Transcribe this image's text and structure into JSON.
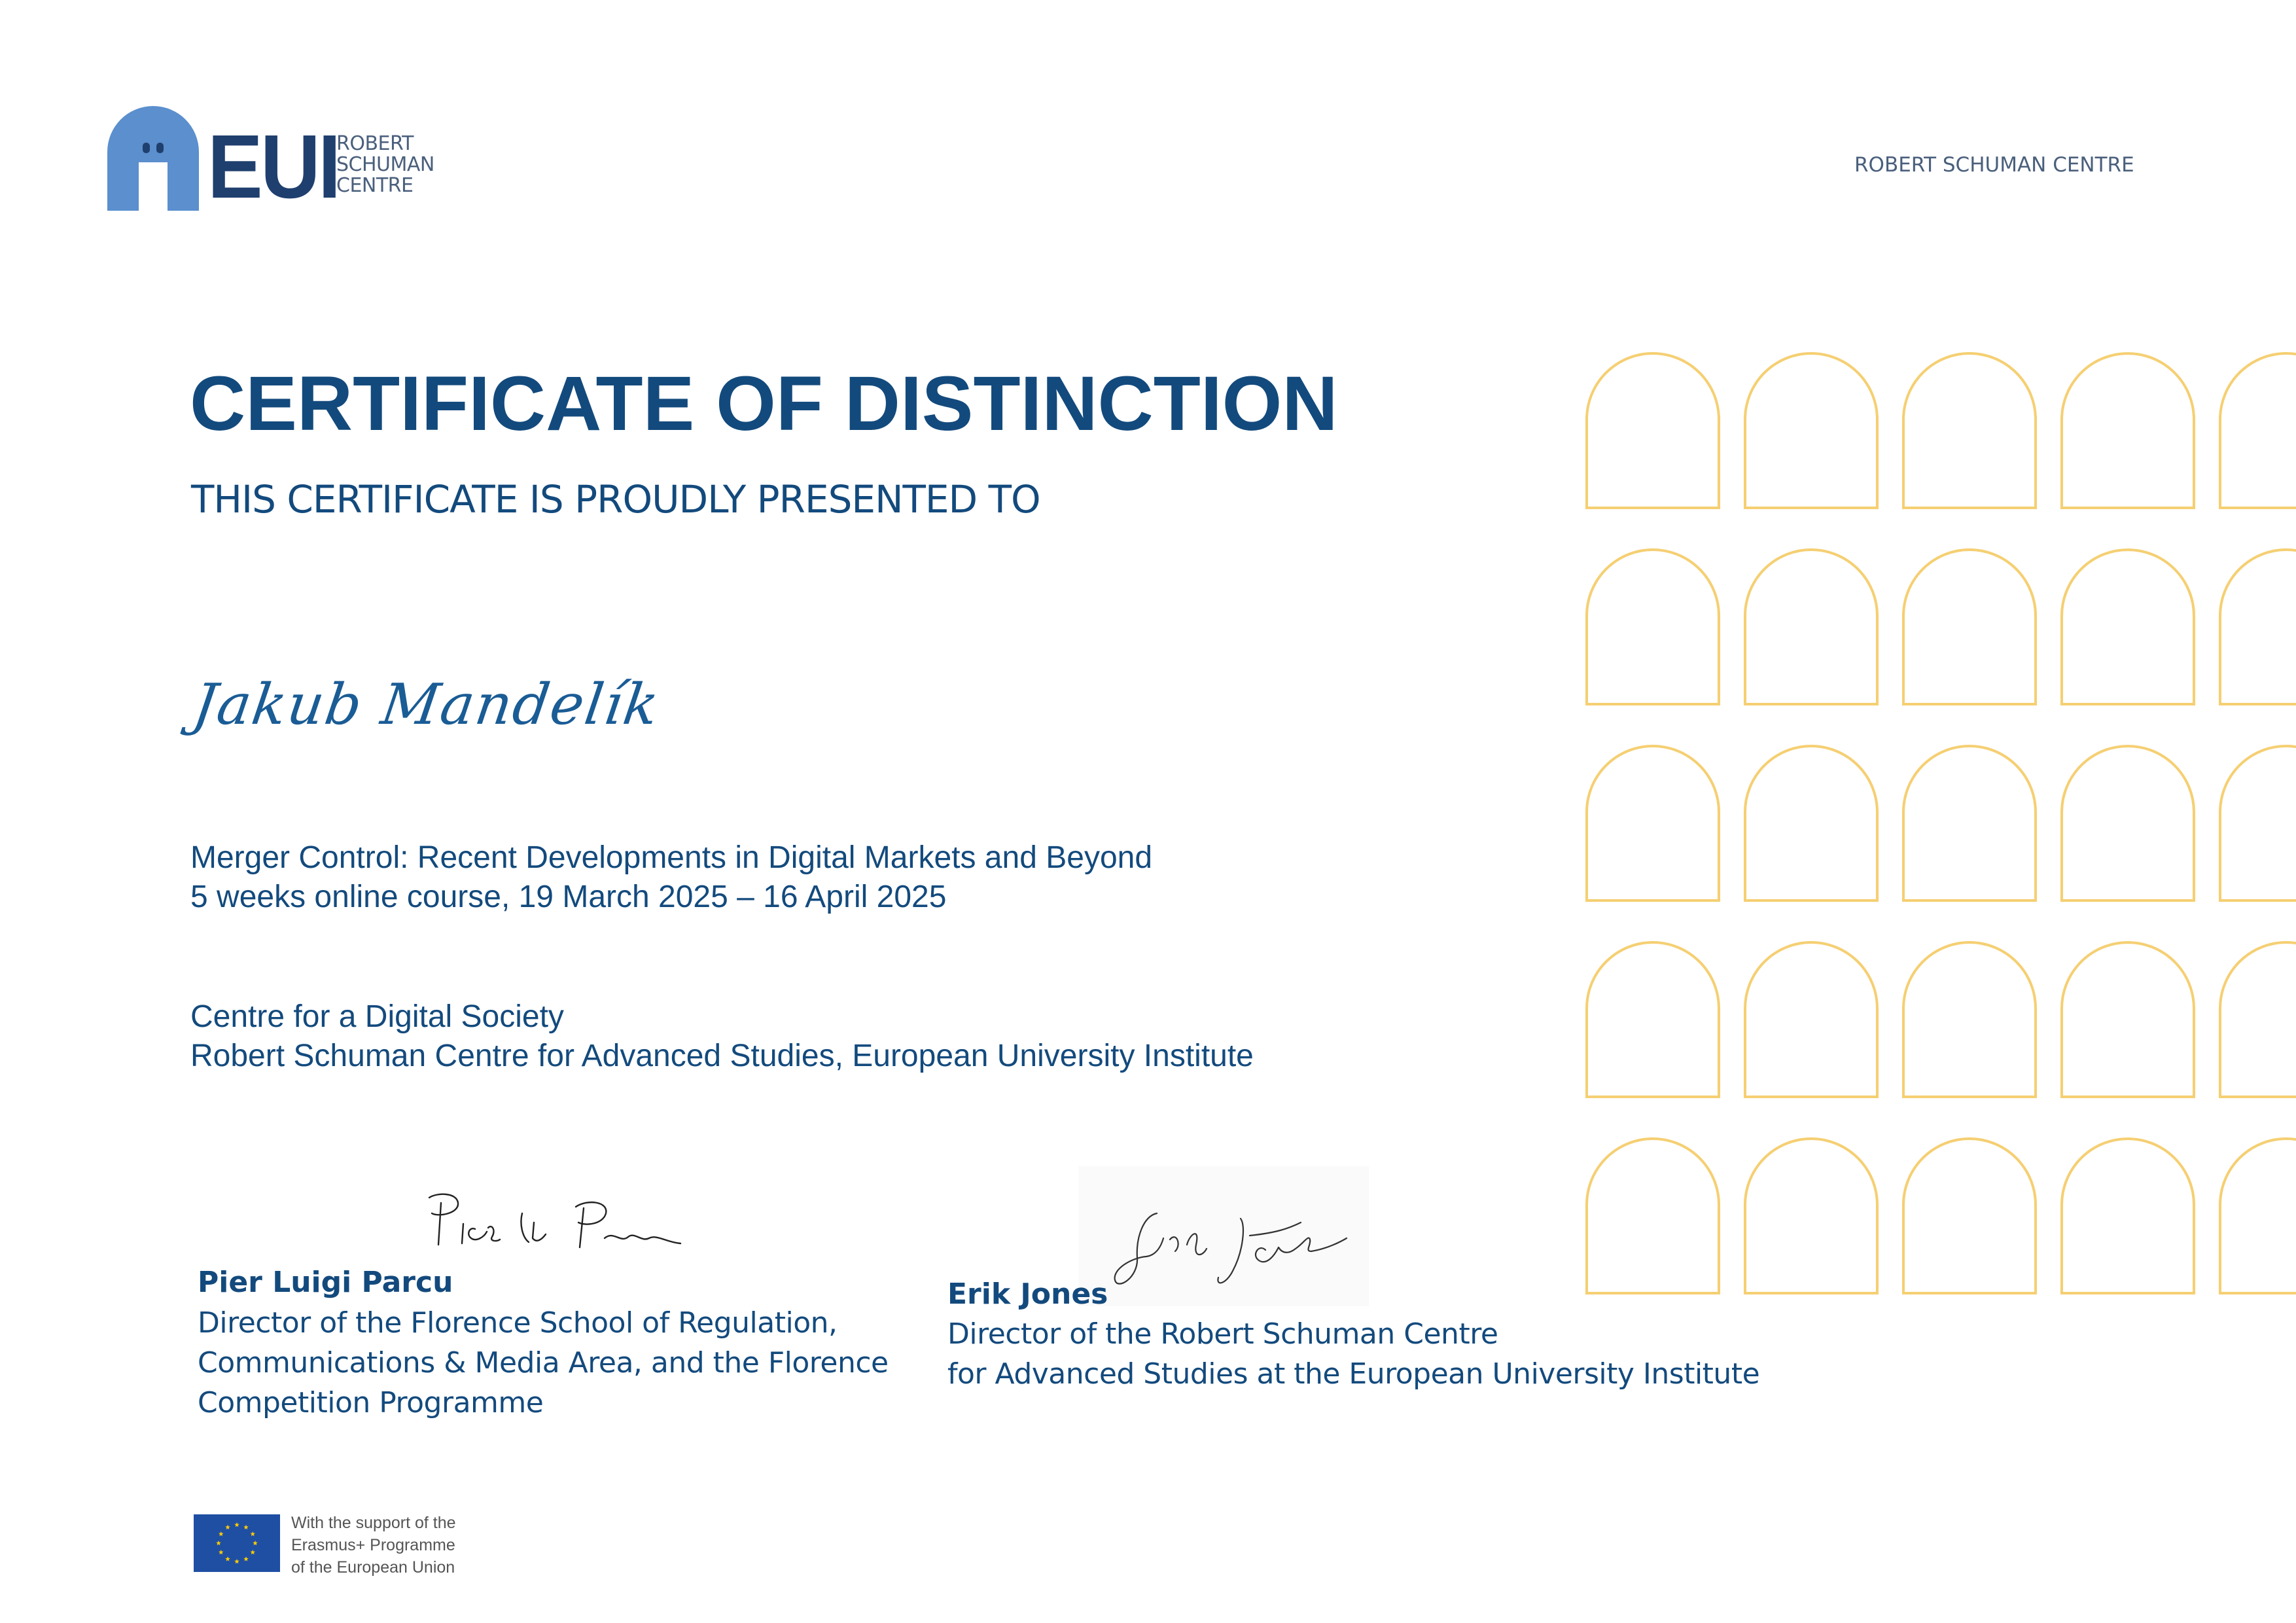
{
  "logo": {
    "mark": "EUI",
    "sub_lines": [
      "ROBERT",
      "SCHUMAN",
      "CENTRE"
    ],
    "colors": {
      "mark_light": "#5b8fce",
      "mark_dark": "#1f3f6e"
    }
  },
  "header_right": "ROBERT SCHUMAN CENTRE",
  "title": "CERTIFICATE OF DISTINCTION",
  "subtitle": "THIS CERTIFICATE IS PROUDLY PRESENTED TO",
  "recipient": "Jakub Mandelík",
  "course": {
    "name": "Merger Control: Recent Developments in Digital Markets and Beyond",
    "dates": "5 weeks online course, 19 March 2025 – 16 April 2025"
  },
  "organization": {
    "centre": "Centre for a Digital Society",
    "institute": "Robert Schuman Centre for Advanced Studies, European University Institute"
  },
  "signatories": [
    {
      "name": "Pier Luigi Parcu",
      "role_lines": [
        "Director of the Florence School of Regulation,",
        "Communications & Media Area, and the Florence",
        "Competition Programme"
      ]
    },
    {
      "name": "Erik Jones",
      "role_lines": [
        "Director of the Robert Schuman Centre",
        "for Advanced Studies at the European University Institute"
      ]
    }
  ],
  "erasmus": {
    "lines": [
      "With the support of the",
      "Erasmus+ Programme",
      "of the European Union"
    ]
  },
  "decoration": {
    "arch_color": "#f5cf72",
    "arch_rows": 5,
    "arch_cols": 5,
    "icon": "arch-pattern"
  },
  "theme": {
    "primary": "#134a7d",
    "eu_blue": "#1f4fa3",
    "eu_star": "#ffcc00"
  }
}
